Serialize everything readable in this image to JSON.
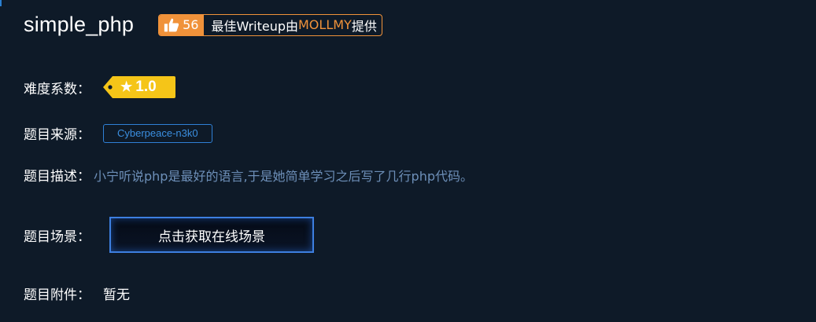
{
  "challenge": {
    "title": "simple_php",
    "likes": "56",
    "writeup_prefix": "最佳Writeup由",
    "writeup_author": "MOLLMY",
    "writeup_suffix": "提供"
  },
  "difficulty": {
    "label": "难度系数：",
    "value": "1.0",
    "star_icon": "★",
    "tag_color": "#f5c518"
  },
  "source": {
    "label": "题目来源：",
    "value": "Cyberpeace-n3k0"
  },
  "description": {
    "label": "题目描述：",
    "value": "小宁听说php是最好的语言,于是她简单学习之后写了几行php代码。"
  },
  "scene": {
    "label": "题目场景：",
    "button_label": "点击获取在线场景"
  },
  "attachment": {
    "label": "题目附件：",
    "value": "暂无"
  },
  "colors": {
    "background": "#0e1a28",
    "accent_orange": "#f0923a",
    "accent_blue": "#2f80d6",
    "description_text": "#6d8fb8"
  }
}
